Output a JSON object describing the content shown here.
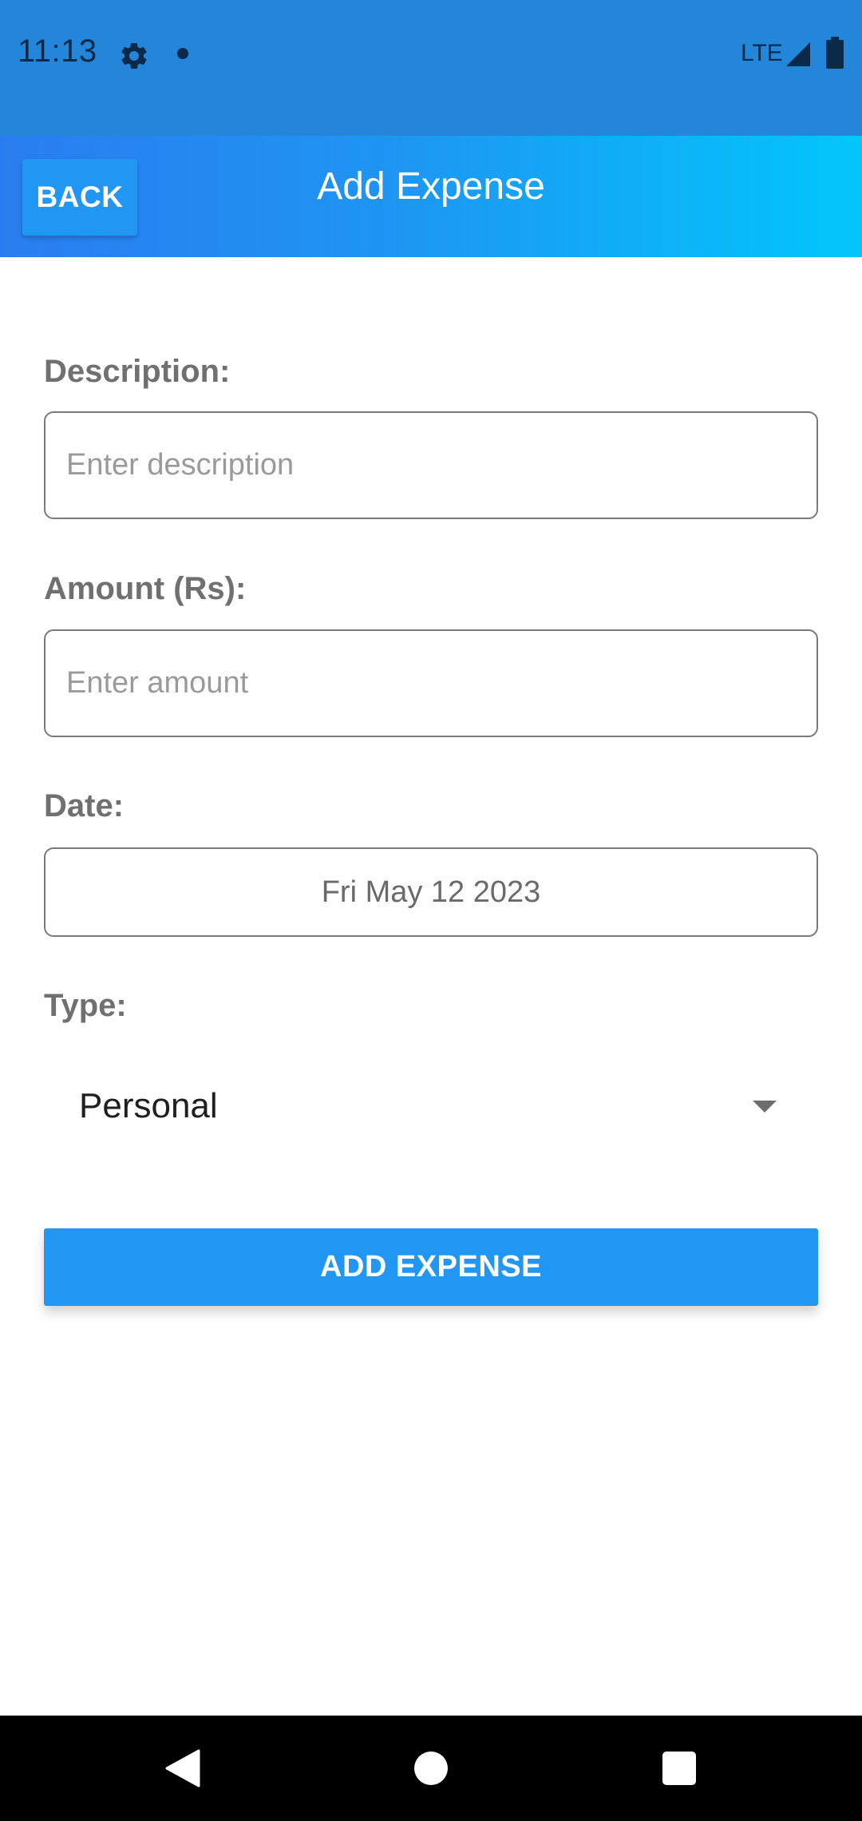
{
  "status_bar": {
    "time": "11:13",
    "network": "LTE",
    "icons": [
      "gear-icon",
      "notification-dot-icon",
      "signal-icon",
      "battery-icon"
    ],
    "background_color": "#2486d9"
  },
  "header": {
    "back_label": "BACK",
    "title": "Add Expense",
    "gradient": [
      "#2a7df0",
      "#02c6fb"
    ]
  },
  "form": {
    "description": {
      "label": "Description:",
      "value": "",
      "placeholder": "Enter description"
    },
    "amount": {
      "label": "Amount (Rs):",
      "value": "",
      "placeholder": "Enter amount"
    },
    "date": {
      "label": "Date:",
      "value": "Fri May 12 2023"
    },
    "type": {
      "label": "Type:",
      "selected": "Personal"
    },
    "submit_label": "ADD EXPENSE",
    "accent_color": "#2196f3"
  },
  "nav_bar": {
    "icons": [
      "back-icon",
      "home-icon",
      "recents-icon"
    ]
  }
}
